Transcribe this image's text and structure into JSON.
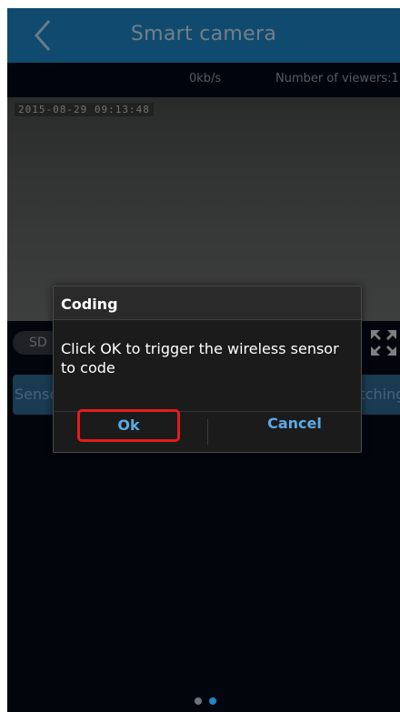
{
  "header": {
    "title": "Smart camera",
    "back_icon": "chevron-left-icon"
  },
  "stream": {
    "speed": "0kb/s",
    "viewers": "Number of viewers:1",
    "timestamp": "2015-08-29  09:13:48"
  },
  "controls": {
    "quality": "SD",
    "fullscreen_icon": "fullscreen-icon",
    "sensor_matching": "Sensor Matching",
    "remote_matching": "Remote Matching"
  },
  "dialog": {
    "title": "Coding",
    "message": "Click OK to trigger the wireless sensor to code",
    "ok_label": "Ok",
    "cancel_label": "Cancel"
  },
  "pager": {
    "count": 2,
    "active_index": 1
  },
  "colors": {
    "header_bg": "#1e88c8",
    "dialog_accent": "#5aaae6",
    "highlight": "#e61c1c"
  }
}
